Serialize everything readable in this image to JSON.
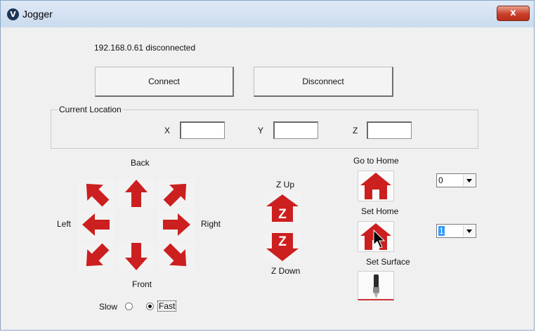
{
  "window": {
    "title": "Jogger",
    "app_icon_glyph": "V",
    "close_glyph": "x"
  },
  "connection": {
    "status": "192.168.0.61  disconnected",
    "connect_label": "Connect",
    "disconnect_label": "Disconnect"
  },
  "location": {
    "group_label": "Current Location",
    "x_label": "X",
    "x_value": "",
    "y_label": "Y",
    "y_value": "",
    "z_label": "Z",
    "z_value": ""
  },
  "jog": {
    "back_label": "Back",
    "front_label": "Front",
    "left_label": "Left",
    "right_label": "Right",
    "arrow_color": "#cc1f1f"
  },
  "z_axis": {
    "up_label": "Z Up",
    "down_label": "Z Down",
    "glyph": "Z"
  },
  "home": {
    "go_home_label": "Go to Home",
    "set_home_label": "Set Home",
    "set_surface_label": "Set Surface",
    "go_home_select": "0",
    "set_home_select": "1"
  },
  "speed": {
    "slow_label": "Slow",
    "fast_label": "Fast",
    "selected": "Fast"
  }
}
